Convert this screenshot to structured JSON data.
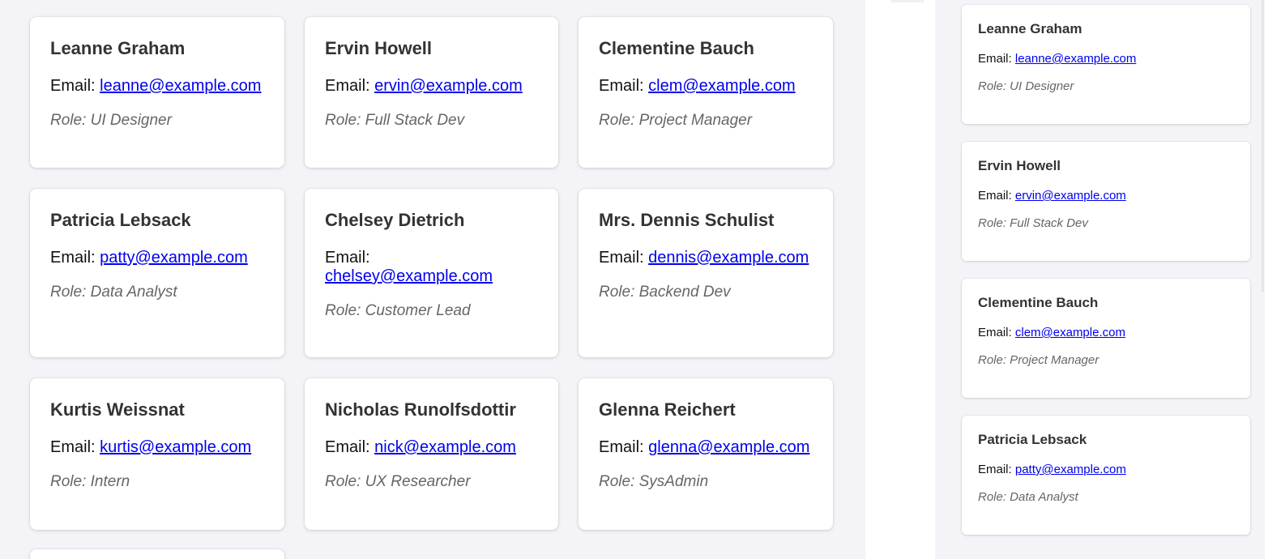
{
  "grid_users": [
    {
      "name": "Leanne Graham",
      "email_label": "Email:",
      "email": "leanne@example.com",
      "role": "Role: UI Designer"
    },
    {
      "name": "Ervin Howell",
      "email_label": "Email:",
      "email": "ervin@example.com",
      "role": "Role: Full Stack Dev"
    },
    {
      "name": "Clementine Bauch",
      "email_label": "Email:",
      "email": "clem@example.com",
      "role": "Role: Project Manager"
    },
    {
      "name": "Patricia Lebsack",
      "email_label": "Email:",
      "email": "patty@example.com",
      "role": "Role: Data Analyst"
    },
    {
      "name": "Chelsey Dietrich",
      "email_label": "Email:",
      "email": "chelsey@example.com",
      "role": "Role: Customer Lead"
    },
    {
      "name": "Mrs. Dennis Schulist",
      "email_label": "Email:",
      "email": "dennis@example.com",
      "role": "Role: Backend Dev"
    },
    {
      "name": "Kurtis Weissnat",
      "email_label": "Email:",
      "email": "kurtis@example.com",
      "role": "Role: Intern"
    },
    {
      "name": "Nicholas Runolfsdottir",
      "email_label": "Email:",
      "email": "nick@example.com",
      "role": "Role: UX Researcher"
    },
    {
      "name": "Glenna Reichert",
      "email_label": "Email:",
      "email": "glenna@example.com",
      "role": "Role: SysAdmin"
    }
  ],
  "list_users": [
    {
      "name": "Leanne Graham",
      "email_label": "Email:",
      "email": "leanne@example.com",
      "role": "Role: UI Designer"
    },
    {
      "name": "Ervin Howell",
      "email_label": "Email:",
      "email": "ervin@example.com",
      "role": "Role: Full Stack Dev"
    },
    {
      "name": "Clementine Bauch",
      "email_label": "Email:",
      "email": "clem@example.com",
      "role": "Role: Project Manager"
    },
    {
      "name": "Patricia Lebsack",
      "email_label": "Email:",
      "email": "patty@example.com",
      "role": "Role: Data Analyst"
    }
  ],
  "colors": {
    "link": "#0000ee",
    "name": "#333333",
    "role": "#666666",
    "background": "#f4f3f8"
  }
}
